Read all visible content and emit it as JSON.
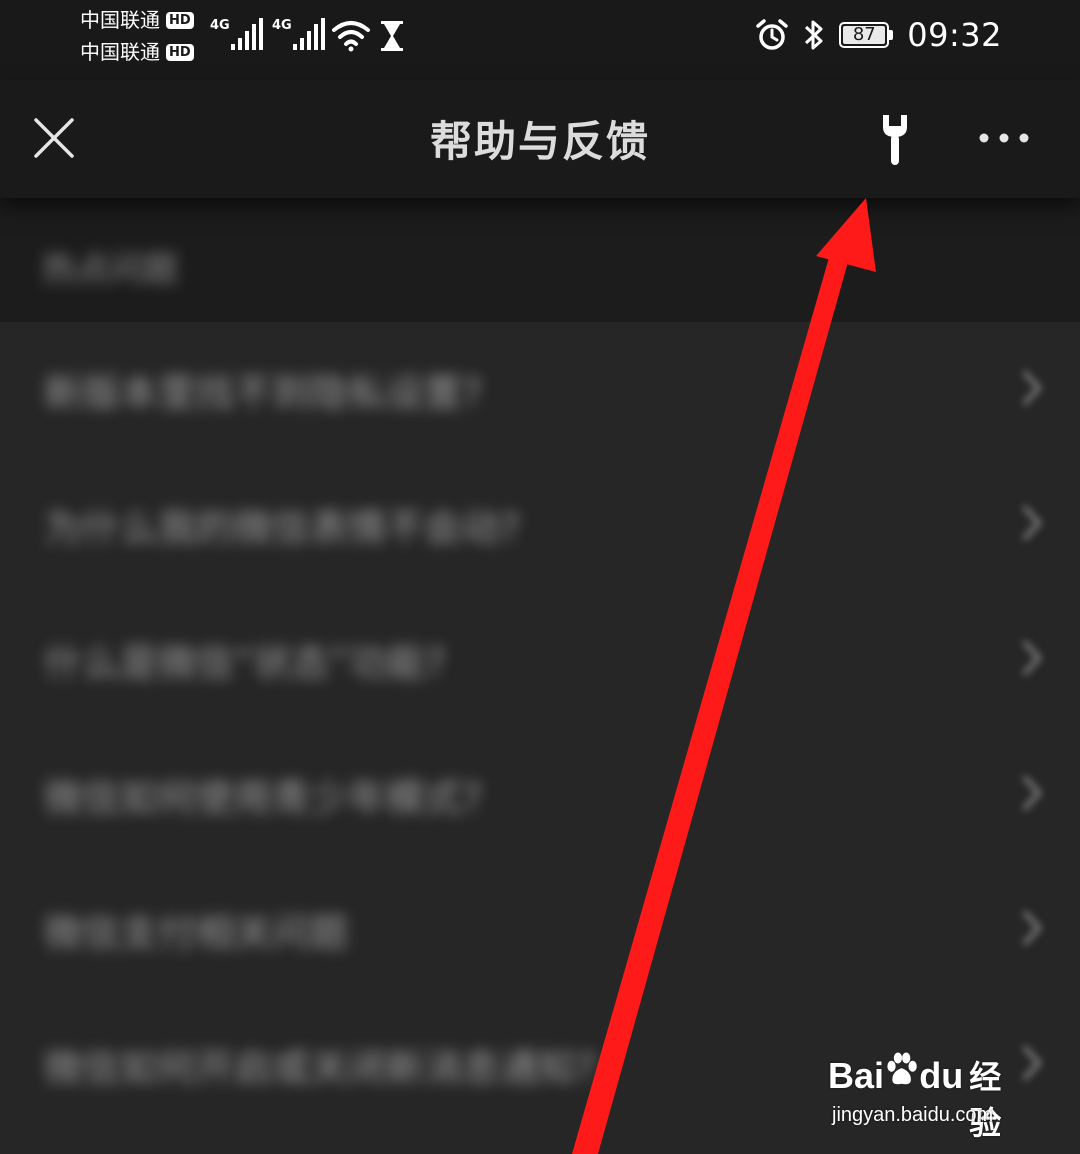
{
  "status_bar": {
    "carrier_1": "中国联通",
    "carrier_2": "中国联通",
    "hd_badge": "HD",
    "network_1": "4G",
    "network_2": "4G",
    "battery_percent": "87",
    "time": "09:32"
  },
  "nav": {
    "title": "帮助与反馈",
    "icons": {
      "close": "close-icon",
      "tool": "wrench-icon",
      "more": "more-horizontal-icon"
    }
  },
  "content": {
    "section_header": "热点问题",
    "faq_items": [
      "新版本里找不到隐私设置?",
      "为什么我的微信表情不会动?",
      "什么是微信“状态”功能?",
      "微信如何使用青少年模式?",
      "微信支付相关问题",
      "微信如何开启或关闭新消息通知?"
    ]
  },
  "annotation": {
    "arrow_color": "#ff1a1a"
  },
  "watermark": {
    "brand_left": "Bai",
    "brand_right": "du",
    "brand_cn": "经验",
    "url": "jingyan.baidu.com"
  }
}
